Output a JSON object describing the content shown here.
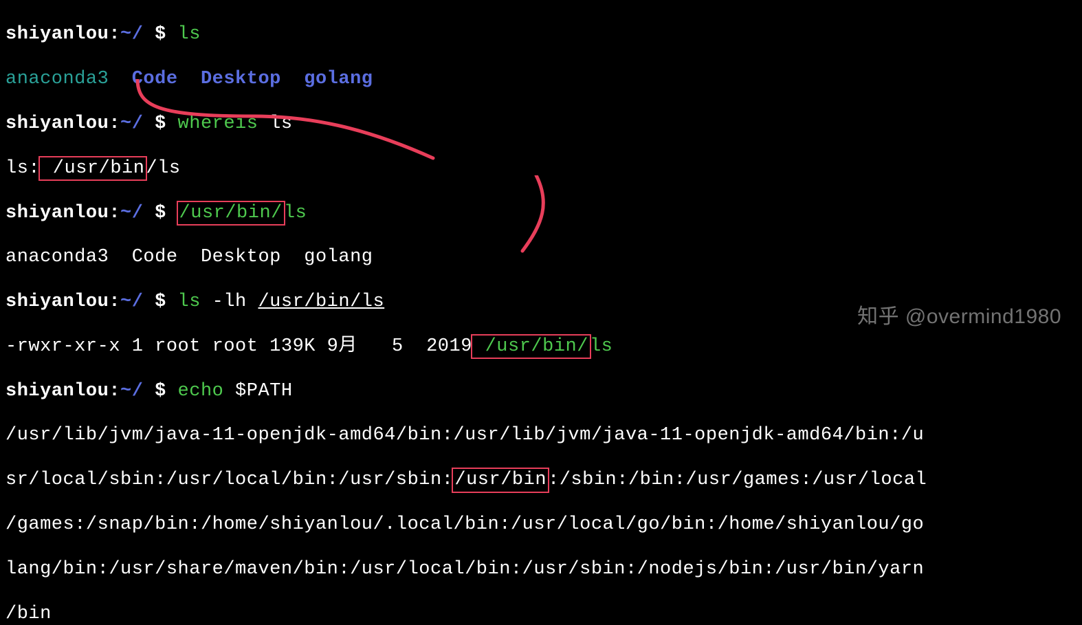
{
  "prompt": {
    "user": "shiyanlou",
    "sep": ":",
    "path": "~/",
    "dollar": " $ "
  },
  "lines": {
    "l1_cmd": "ls",
    "l2_out": {
      "a": "anaconda3",
      "b": "Code",
      "c": "Desktop",
      "d": "golang"
    },
    "l3_cmd": "whereis",
    "l3_arg": " ls",
    "l4_prefix": "ls:",
    "l4_box": " /usr/bin",
    "l4_suffix": "/ls",
    "l5_box": "/usr/bin/",
    "l5_suffix": "ls",
    "l6_out": "anaconda3  Code  Desktop  golang",
    "l7_cmd": "ls",
    "l7_flags": " -lh ",
    "l7_path": "/usr/bin/ls",
    "l8_perms": "-rwxr-xr-x 1 root root 139K 9月   5  2019",
    "l8_box": " /usr/bin/",
    "l8_suffix": "ls",
    "l9_cmd": "echo",
    "l9_arg": " $PATH",
    "l10a": "/usr/lib/jvm/java-11-openjdk-amd64/bin:/usr/lib/jvm/java-11-openjdk-amd64/bin:/u",
    "l10b_pre": "sr/local/sbin:/usr/local/bin:/usr/sbin:",
    "l10b_box": "/usr/bin",
    "l10b_post": ":/sbin:/bin:/usr/games:/usr/local",
    "l10c": "/games:/snap/bin:/home/shiyanlou/.local/bin:/usr/local/go/bin:/home/shiyanlou/go",
    "l10d": "lang/bin:/usr/share/maven/bin:/usr/local/bin:/usr/sbin:/nodejs/bin:/usr/bin/yarn",
    "l10e": "/bin"
  },
  "watermark": {
    "zh": "知乎 ",
    "at": "@overmind1980"
  },
  "colors": {
    "annotation": "#e83e5a"
  }
}
